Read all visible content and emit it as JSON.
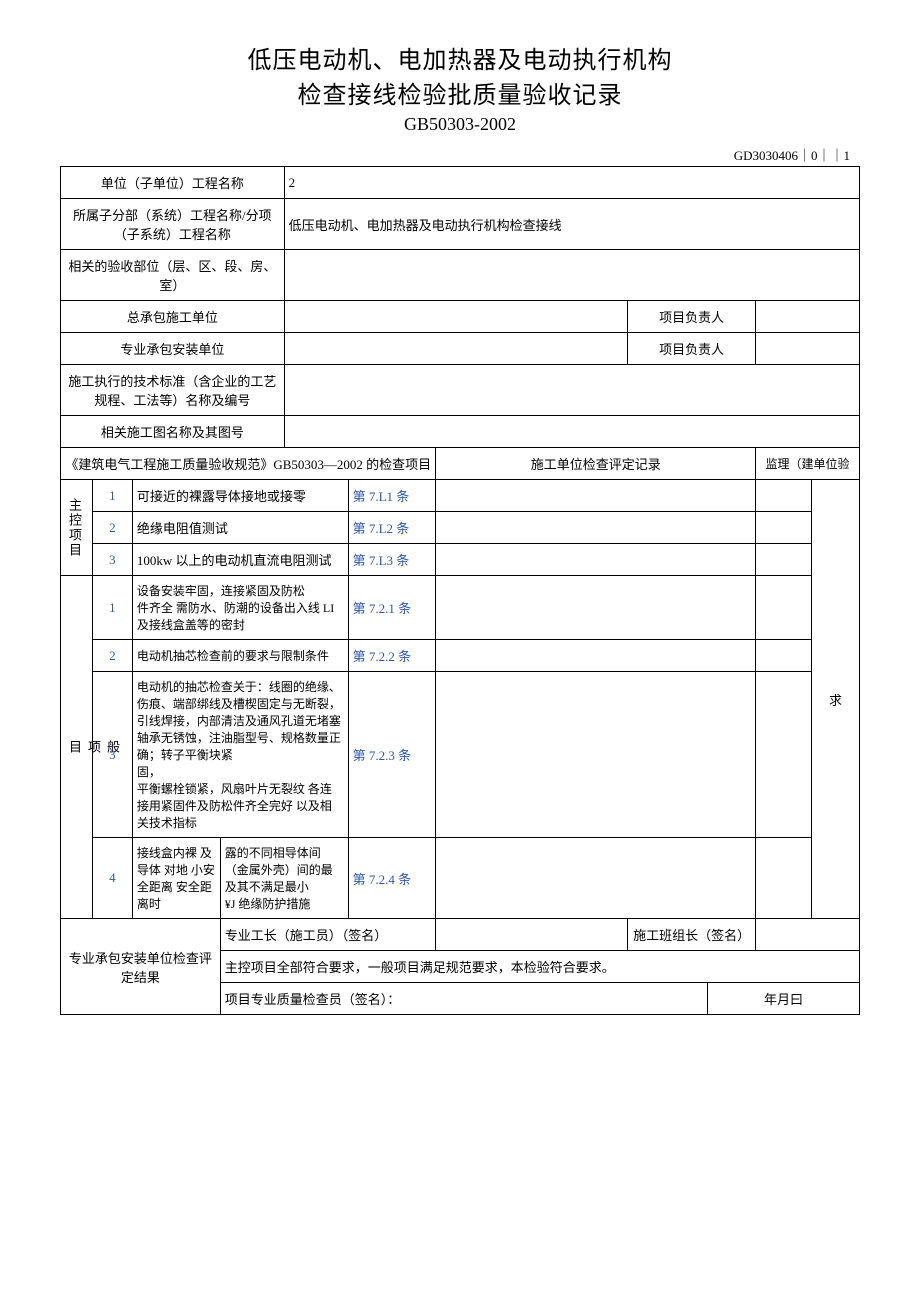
{
  "header": {
    "title_line1": "低压电动机、电加热器及电动执行机构",
    "title_line2": "检查接线检验批质量验收记录",
    "standard_code": "GB50303-2002",
    "doc_code": "GD3030406｜0｜｜1"
  },
  "meta": {
    "unit_project_label": "单位（子单位）工程名称",
    "unit_project_value": "2",
    "sub_project_label": "所属子分部（系统）工程名称/分项（子系统）工程名称",
    "sub_project_value": "低压电动机、电加热器及电动执行机构检查接线",
    "accept_location_label": "相关的验收部位（层、区、段、房、室）",
    "contractor_label": "总承包施工单位",
    "pm_label": "项目负责人",
    "subcontractor_label": "专业承包安装单位",
    "tech_std_label": "施工执行的技术标准（含企业的工艺规程、工法等）名称及编号",
    "drawings_label": "相关施工图名称及其图号"
  },
  "columns": {
    "check_items": "《建筑电气工程施工质量验收规范》GB50303—2002 的检查项目",
    "record": "施工单位检查评定记录",
    "supervisor": "监理（建单位验",
    "extra": "求"
  },
  "groups": {
    "main": "主控项目",
    "general": "般\n项\n目"
  },
  "main_items": [
    {
      "n": "1",
      "desc": "可接近的裸露导体接地或接零",
      "ref": "第 7.L1 条"
    },
    {
      "n": "2",
      "desc": "绝缘电阻值测试",
      "ref": "第 7.L2 条"
    },
    {
      "n": "3",
      "desc": "100kw 以上的电动机直流电阻测试",
      "ref": "第 7.L3 条"
    }
  ],
  "general_items": [
    {
      "n": "1",
      "desc": "设备安装牢固，连接紧固及防松\n件齐全 需防水、防潮的设备出入线 LI 及接线盒盖等的密封",
      "ref": "第 7.2.1 条"
    },
    {
      "n": "2",
      "desc": "电动机抽芯检查前的要求与限制条件",
      "ref": "第 7.2.2 条"
    },
    {
      "n": "3",
      "desc": "电动机的抽芯检查关于：线圈的绝缘、伤痕、端部绑线及槽楔固定与无断裂，引线焊接，内部清洁及通风孔道无堵塞 轴承无锈蚀，注油脂型号、规格数量正确；转子平衡块紧\n固，\n平衡螺栓锁紧，风扇叶片无裂纹 各连接用紧固件及防松件齐全完好 以及相关技术指标",
      "ref": "第 7.2.3 条"
    },
    {
      "n": "4",
      "desc_a": "接线盒内裸 及导体 对地 小安全距离 安全距离时",
      "desc_b": "露的不同相导体间（金属外壳）间的最及其不满足最小\n¥J 绝缘防护措施",
      "ref": "第 7.2.4 条"
    }
  ],
  "footer": {
    "section_label": "专业承包安装单位检查评定结果",
    "foreman_label": "专业工长（施工员）（签名）",
    "team_leader_label": "施工班组长（签名）",
    "conclusion": "主控项目全部符合要求，一般项目满足规范要求，本检验符合要求。",
    "qc_label": "项目专业质量检查员（签名）：",
    "date_label": "年月曰"
  }
}
